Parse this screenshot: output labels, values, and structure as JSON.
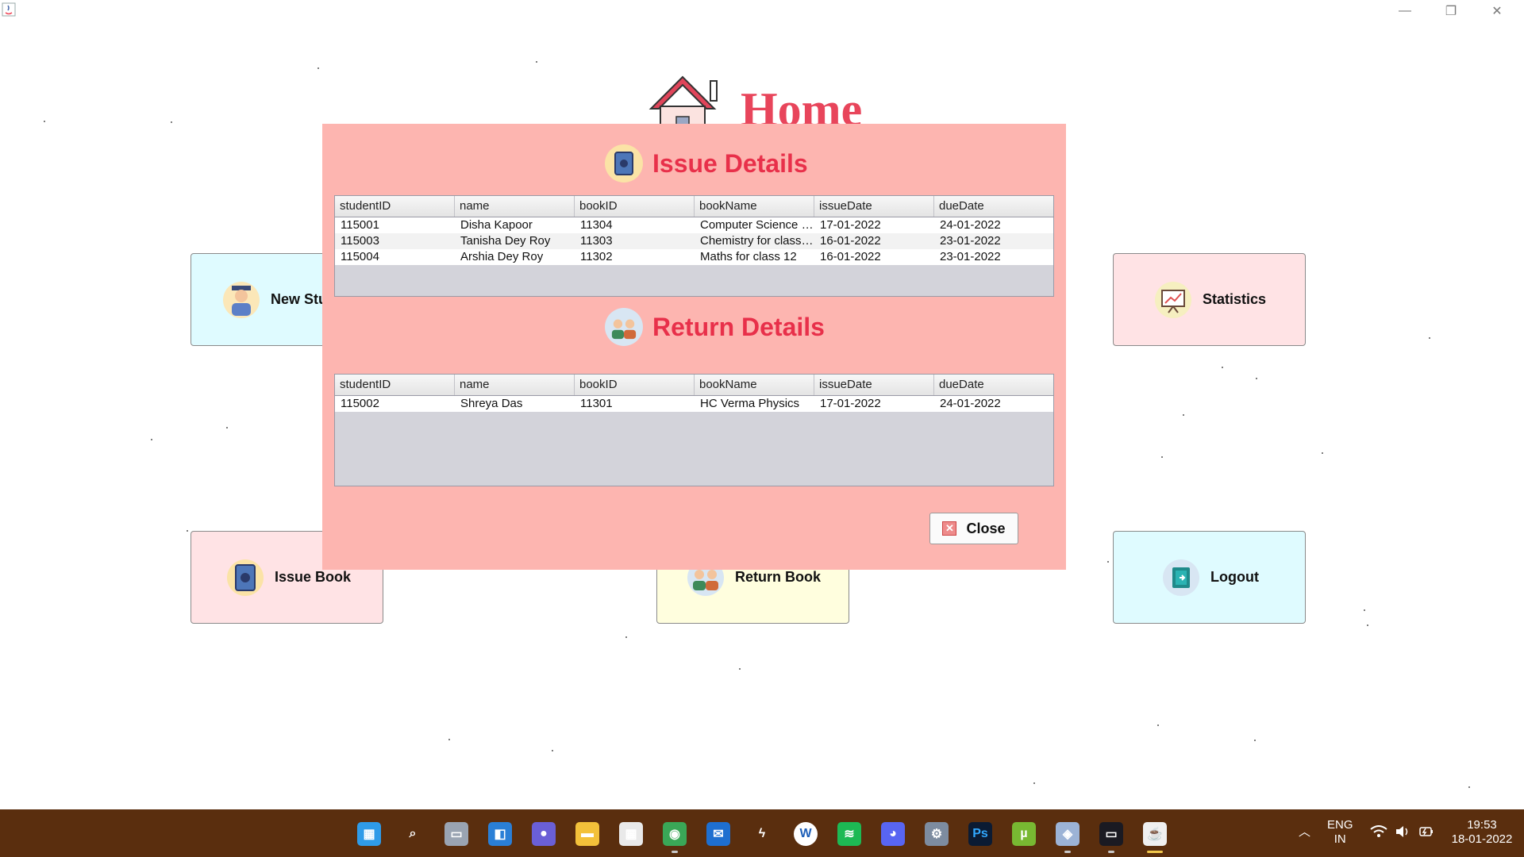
{
  "window": {
    "minimize_glyph": "—",
    "maximize_glyph": "❐",
    "close_glyph": "✕"
  },
  "home": {
    "title": "Home"
  },
  "buttons": {
    "new_student": "New Student",
    "statistics": "Statistics",
    "issue_book": "Issue Book",
    "return_book": "Return Book",
    "logout": "Logout"
  },
  "dialog": {
    "issue_title": "Issue Details",
    "return_title": "Return Details",
    "close_label": "Close",
    "columns": [
      "studentID",
      "name",
      "bookID",
      "bookName",
      "issueDate",
      "dueDate"
    ],
    "issue_rows": [
      [
        "115001",
        "Disha Kapoor",
        "11304",
        "Computer Science f...",
        "17-01-2022",
        "24-01-2022"
      ],
      [
        "115003",
        "Tanisha Dey Roy",
        "11303",
        "Chemistry for class ...",
        "16-01-2022",
        "23-01-2022"
      ],
      [
        "115004",
        "Arshia Dey Roy",
        "11302",
        "Maths for class 12",
        "16-01-2022",
        "23-01-2022"
      ]
    ],
    "return_rows": [
      [
        "115002",
        "Shreya Das",
        "11301",
        "HC Verma Physics",
        "17-01-2022",
        "24-01-2022"
      ]
    ]
  },
  "taskbar": {
    "icons": [
      "windows-start-icon",
      "search-icon",
      "task-view-icon",
      "widgets-icon",
      "teams-chat-icon",
      "file-explorer-icon",
      "microsoft-store-icon",
      "chrome-icon",
      "mail-icon",
      "bolt-app-icon",
      "word-icon",
      "spotify-icon",
      "discord-icon",
      "settings-icon",
      "photoshop-icon",
      "utorrent-icon",
      "virtualbox-icon",
      "mysql-terminal-icon",
      "java-app-icon"
    ],
    "photoshop_label": "Ps",
    "lang_top": "ENG",
    "lang_bottom": "IN",
    "time": "19:53",
    "date": "18-01-2022"
  },
  "colors": {
    "dialog_bg": "#fdb5b0",
    "title_red": "#e8304a",
    "taskbar_bg": "#5a2e0e",
    "btn_cyan": "#dffbff",
    "btn_pink": "#ffe3e5",
    "btn_yellow": "#fffede"
  }
}
